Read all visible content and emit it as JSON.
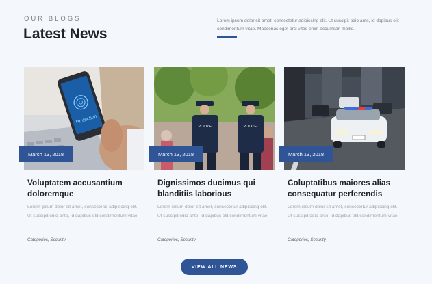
{
  "section": {
    "eyebrow": "OUR BLOGS",
    "title": "Latest News",
    "intro": "Lorem ipsum dolor sit amet, consectetur adipiscing elit. Ut suscipit odio ante, id dapibus elit condimentum vitae. Maecenas eget orci vitae enim accumsan mollis."
  },
  "posts": [
    {
      "date": "March 13, 2018",
      "title": "Voluptatem accusantium doloremque",
      "excerpt": "Lorem ipsum dolor sit amet, consectetur adipiscing elit. Ut suscipit odio ante, id dapibus elit condimentum vitae.",
      "meta": "Categories, Security",
      "image_text": "Protection"
    },
    {
      "date": "March 13, 2018",
      "title": "Dignissimos ducimus qui blanditiis laborious",
      "excerpt": "Lorem ipsum dolor sit amet, consectetur adipiscing elit. Ut suscipit odio ante, id dapibus elit condimentum vitae.",
      "meta": "Categories, Security",
      "image_text": "POLIZEI"
    },
    {
      "date": "March 13, 2018",
      "title": "Coluptatibus maiores alias consequatur perferendis",
      "excerpt": "Lorem ipsum dolor sit amet, consectetur adipiscing elit. Ut suscipit odio ante, id dapibus elit condimentum vitae.",
      "meta": "Categories, Security",
      "image_text": ""
    }
  ],
  "cta": {
    "label": "VIEW ALL NEWS"
  },
  "colors": {
    "accent": "#2f5597",
    "background": "#f4f7fb",
    "heading": "#1f2228"
  }
}
